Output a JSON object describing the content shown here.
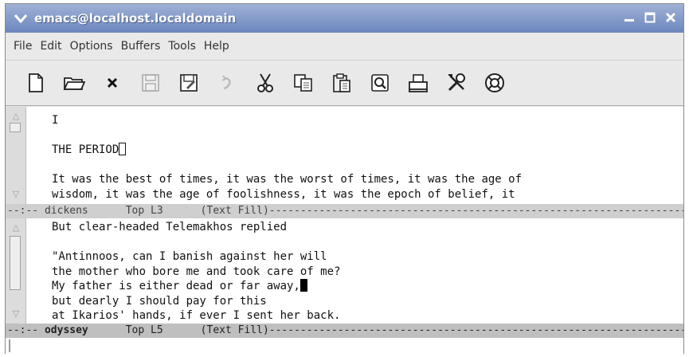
{
  "titlebar": {
    "title": "emacs@localhost.localdomain"
  },
  "menubar": {
    "items": [
      "File",
      "Edit",
      "Options",
      "Buffers",
      "Tools",
      "Help"
    ]
  },
  "toolbar": {
    "buttons": [
      "new-file-icon",
      "open-folder-icon",
      "close-buffer-icon",
      "save-icon",
      "save-as-icon",
      "undo-icon",
      "cut-icon",
      "copy-icon",
      "paste-icon",
      "search-icon",
      "print-icon",
      "customize-icon",
      "help-icon"
    ]
  },
  "pane1": {
    "lines": [
      "I",
      "",
      "THE PERIOD",
      "",
      "It was the best of times, it was the worst of times, it was the age of",
      "wisdom, it was the age of foolishness, it was the epoch of belief, it"
    ]
  },
  "modeline1": {
    "prefix": "--:-- ",
    "buffer": "dickens",
    "position": "Top L3",
    "mode": "(Text Fill)",
    "fill": "-----------------------------------------------------------------------"
  },
  "pane2": {
    "lines": [
      "But clear-headed Telemakhos replied",
      "",
      "\"Antinnoos, can I banish against her will",
      "the mother who bore me and took care of me?",
      "My father is either dead or far away,",
      "but dearly I should pay for this",
      "at Ikarios' hands, if ever I sent her back."
    ]
  },
  "modeline2": {
    "prefix": "--:-- ",
    "buffer": "odyssey",
    "position": "Top L5",
    "mode": "(Text Fill)",
    "fill": "-----------------------------------------------------------------------"
  }
}
